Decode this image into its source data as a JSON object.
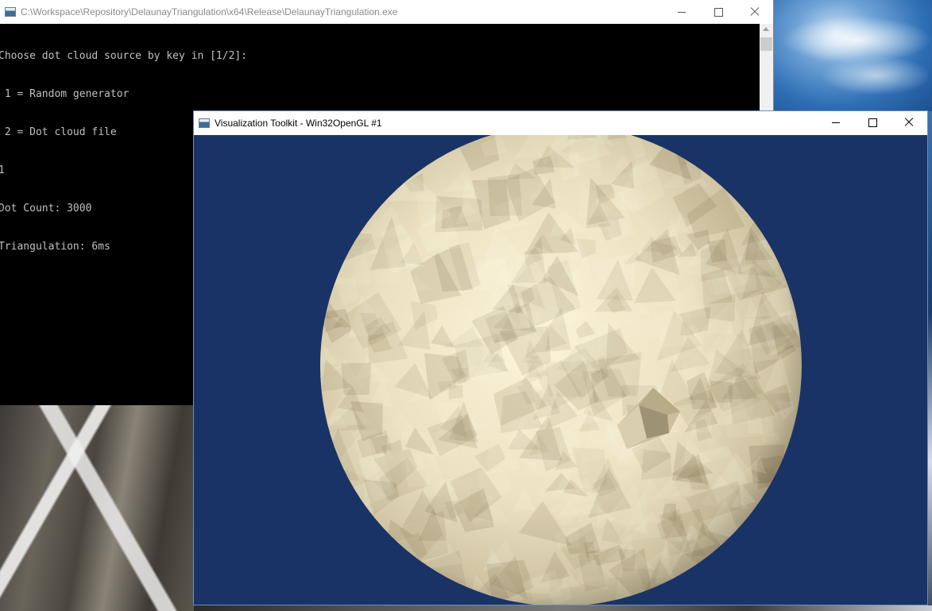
{
  "console": {
    "title": "C:\\Workspace\\Repository\\DelaunayTriangulation\\x64\\Release\\DelaunayTriangulation.exe",
    "lines": [
      "Choose dot cloud source by key in [1/2]:",
      " 1 = Random generator",
      " 2 = Dot cloud file",
      "1",
      "Dot Count: 3000",
      "Triangulation: 6ms"
    ]
  },
  "vtk_window": {
    "title": "Visualization Toolkit - Win32OpenGL #1",
    "background_color": "#1a3366",
    "sphere_color": "#ede4c4"
  }
}
